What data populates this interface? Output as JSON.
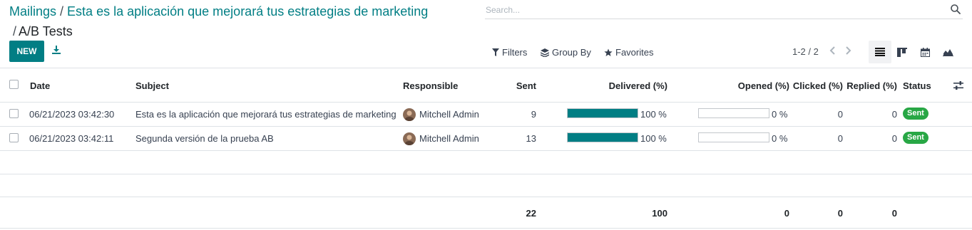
{
  "breadcrumb": {
    "root": "Mailings",
    "record": "Esta es la aplicación que mejorará tus estrategias de marketing",
    "current": "A/B Tests",
    "separator": "/"
  },
  "search": {
    "placeholder": "Search..."
  },
  "toolbar": {
    "new_label": "NEW",
    "filters_label": "Filters",
    "groupby_label": "Group By",
    "favorites_label": "Favorites",
    "pager": "1-2 / 2"
  },
  "columns": {
    "date": "Date",
    "subject": "Subject",
    "responsible": "Responsible",
    "sent": "Sent",
    "delivered": "Delivered (%)",
    "opened": "Opened (%)",
    "clicked": "Clicked (%)",
    "replied": "Replied (%)",
    "status": "Status"
  },
  "rows": [
    {
      "date": "06/21/2023 03:42:30",
      "subject": "Esta es la aplicación que mejorará tus estrategias de marketing",
      "responsible": "Mitchell Admin",
      "sent": "9",
      "delivered_pct": 100,
      "delivered_label": "100 %",
      "opened_pct": 0,
      "opened_label": "0 %",
      "clicked": "0",
      "replied": "0",
      "status": "Sent"
    },
    {
      "date": "06/21/2023 03:42:11",
      "subject": "Segunda versión de la prueba AB",
      "responsible": "Mitchell Admin",
      "sent": "13",
      "delivered_pct": 100,
      "delivered_label": "100 %",
      "opened_pct": 0,
      "opened_label": "0 %",
      "clicked": "0",
      "replied": "0",
      "status": "Sent"
    }
  ],
  "totals": {
    "sent": "22",
    "delivered": "100",
    "opened": "0",
    "clicked": "0",
    "replied": "0"
  },
  "colors": {
    "brand": "#017e84",
    "status_sent": "#28a745"
  },
  "icons": {
    "search": "search-icon",
    "download": "download-icon",
    "filter": "filter-icon",
    "groupby": "layers-icon",
    "favorites": "star-icon",
    "prev": "chevron-left-icon",
    "next": "chevron-right-icon",
    "list_view": "list-view-icon",
    "kanban_view": "kanban-view-icon",
    "calendar_view": "calendar-view-icon",
    "graph_view": "graph-view-icon",
    "optional_columns": "sliders-icon"
  }
}
